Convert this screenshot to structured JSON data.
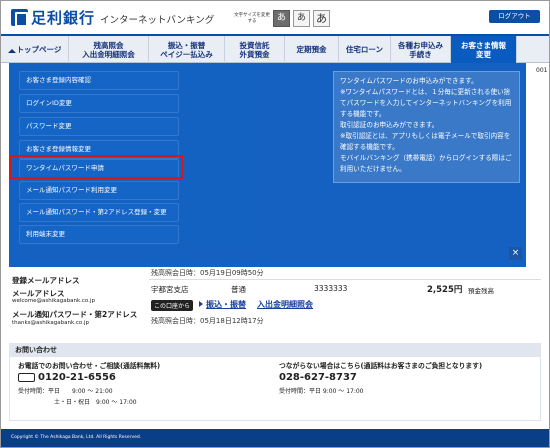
{
  "header": {
    "bank_name": "足利銀行",
    "service_name": "インターネットバンキング",
    "font_size_label": "文字サイズを変更する",
    "font_sizes": [
      "あ",
      "あ"
    ],
    "font_size_active": "あ",
    "logout_label": "ログアウト"
  },
  "nav": {
    "items": [
      {
        "label": "トップページ"
      },
      {
        "label": "残高照会\n入出金明細照会"
      },
      {
        "label": "振込・振替\nペイジー払込み"
      },
      {
        "label": "投資信託\n外貨預金"
      },
      {
        "label": "定期預金"
      },
      {
        "label": "住宅ローン"
      },
      {
        "label": "各種お申込み\n手続き"
      },
      {
        "label": "お客さま情報\n変更"
      }
    ]
  },
  "dropdown": {
    "items": [
      "お客さま登録内容確認",
      "ログインID変更",
      "パスワード変更",
      "お客さま登録情報変更",
      "ワンタイムパスワード申請",
      "メール通知パスワード利用変更",
      "メール通知パスワード・第2アドレス登録・変更",
      "利用端末変更"
    ],
    "highlighted_index": 4,
    "description": "ワンタイムパスワードのお申込みができます。\n※ワンタイムパスワードとは、１分毎に更新される使い捨てパスワードを入力してインターネットバンキングを利用する機能です。\n取引認証のお申込みができます。\n※取引認証とは、アプリもしくは電子メールで取引内容を確認する機能です。\nモバイルバンキング（携帯電話）からログインする際はご利用いただけません。",
    "close_label": "×"
  },
  "account": {
    "partial_text": "001",
    "balance_date_1": "残高照会日時：05月19日09時50分",
    "branch": "宇都宮支店",
    "type": "普通",
    "number": "3333333",
    "balance": "2,525円",
    "balance_label": "預金残高",
    "from_account_badge": "この口座から",
    "links": [
      "振込・振替",
      "入出金明細照会"
    ],
    "balance_date_2": "残高照会日時：05月18日12時17分"
  },
  "registered": {
    "email_title": "登録メールアドレス",
    "mail_address_label": "メールアドレス",
    "mail_address": "welcome@ashikagabank.co.jp",
    "notify_label": "メール通知パスワード・第2アドレス",
    "notify_address": "thanks@ashikagabank.co.jp"
  },
  "contact": {
    "title": "お問い合わせ",
    "phone_heading": "お電話でのお問い合わせ・ご相談(通話料無料)",
    "phone_number": "0120-21-6556",
    "hours_weekday": "受付時間：平日　　9:00 ～ 21:00",
    "hours_weekend": "土・日・祝日　9:00 ～ 17:00",
    "alt_heading": "つながらない場合はこちら(通話料はお客さまのご負担となります)",
    "alt_number": "028-627-8737",
    "alt_hours": "受付時間：平日 9:00 ～ 17:00"
  },
  "footer": {
    "copyright": "Copyright © The Ashikaga Bank, Ltd. All Rights Reserved."
  },
  "colors": {
    "brand_blue": "#0a4ea5",
    "menu_blue": "#0a5bbf",
    "highlight_red": "#d31919"
  }
}
